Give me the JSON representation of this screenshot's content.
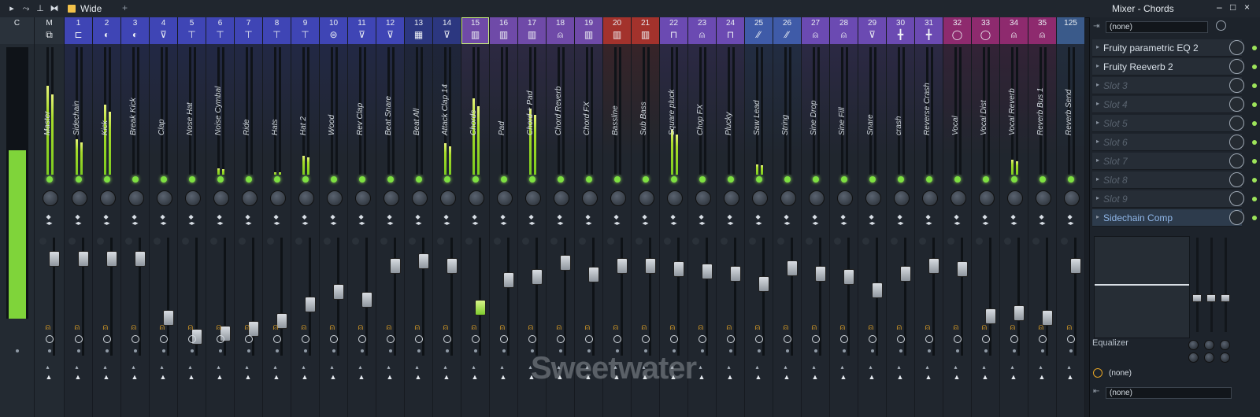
{
  "titlebar": {
    "preset_label": "Wide",
    "plus_label": "+",
    "window_title": "Mixer - Chords",
    "minimize": "–",
    "maximize": "□",
    "close": "×"
  },
  "colors": {
    "accent_green": "#7ee041",
    "meter_fill": "#9fdc2b",
    "route_orange": "#e6a525"
  },
  "tracks": [
    {
      "num": "C",
      "name": "",
      "icon": "",
      "color": "#2a323b",
      "meter": 0.62,
      "fader": 0.0,
      "kind": "current"
    },
    {
      "num": "M",
      "name": "Master",
      "icon": "⧉",
      "color": "#2a323b",
      "meter": 0.7,
      "fader": 0.87
    },
    {
      "num": "1",
      "name": "Sidechain",
      "icon": "⊏",
      "color": "#3f45b5",
      "meter": 0.28,
      "fader": 0.87
    },
    {
      "num": "2",
      "name": "Kick",
      "icon": "◐",
      "color": "#3f45b5",
      "meter": 0.55,
      "fader": 0.87
    },
    {
      "num": "3",
      "name": "Break Kick",
      "icon": "◐",
      "color": "#3f45b5",
      "meter": 0.0,
      "fader": 0.87
    },
    {
      "num": "4",
      "name": "Clap",
      "icon": "⊽",
      "color": "#3f45b5",
      "meter": 0.0,
      "fader": 0.3
    },
    {
      "num": "5",
      "name": "Nose Hat",
      "icon": "⊤",
      "color": "#3f45b5",
      "meter": 0.0,
      "fader": 0.12
    },
    {
      "num": "6",
      "name": "Noise Cymbal",
      "icon": "⊤",
      "color": "#3f45b5",
      "meter": 0.05,
      "fader": 0.15
    },
    {
      "num": "7",
      "name": "Ride",
      "icon": "⊤",
      "color": "#3f45b5",
      "meter": 0.0,
      "fader": 0.2
    },
    {
      "num": "8",
      "name": "Hats",
      "icon": "⊤",
      "color": "#3f45b5",
      "meter": 0.02,
      "fader": 0.27
    },
    {
      "num": "9",
      "name": "Hat 2",
      "icon": "⊤",
      "color": "#3f45b5",
      "meter": 0.15,
      "fader": 0.43
    },
    {
      "num": "10",
      "name": "Wood",
      "icon": "⊜",
      "color": "#3f45b5",
      "meter": 0.0,
      "fader": 0.55
    },
    {
      "num": "11",
      "name": "Rev Clap",
      "icon": "⊽",
      "color": "#3f45b5",
      "meter": 0.0,
      "fader": 0.48
    },
    {
      "num": "12",
      "name": "Beat Snare",
      "icon": "⊽",
      "color": "#3f45b5",
      "meter": 0.0,
      "fader": 0.8
    },
    {
      "num": "13",
      "name": "Beat All",
      "icon": "▦",
      "color": "#2c3780",
      "meter": 0.0,
      "fader": 0.85
    },
    {
      "num": "14",
      "name": "Attack Clap 14",
      "icon": "⊽",
      "color": "#2c3780",
      "meter": 0.25,
      "fader": 0.8
    },
    {
      "num": "15",
      "name": "Chords",
      "icon": "▥",
      "color": "#6f4aa8",
      "meter": 0.6,
      "fader": 0.4,
      "selected": true
    },
    {
      "num": "16",
      "name": "Pad",
      "icon": "▥",
      "color": "#6f4aa8",
      "meter": 0.0,
      "fader": 0.67
    },
    {
      "num": "17",
      "name": "Chord + Pad",
      "icon": "▥",
      "color": "#6f4aa8",
      "meter": 0.52,
      "fader": 0.7
    },
    {
      "num": "18",
      "name": "Chord Reverb",
      "icon": "⍝",
      "color": "#6f4aa8",
      "meter": 0.0,
      "fader": 0.83
    },
    {
      "num": "19",
      "name": "Chord FX",
      "icon": "▥",
      "color": "#6f4aa8",
      "meter": 0.0,
      "fader": 0.72
    },
    {
      "num": "20",
      "name": "Bassline",
      "icon": "▥",
      "color": "#a3322c",
      "meter": 0.0,
      "fader": 0.8
    },
    {
      "num": "21",
      "name": "Sub Bass",
      "icon": "▥",
      "color": "#a3322c",
      "meter": 0.0,
      "fader": 0.8
    },
    {
      "num": "22",
      "name": "Square pluck",
      "icon": "⊓",
      "color": "#6b4ab2",
      "meter": 0.35,
      "fader": 0.77
    },
    {
      "num": "23",
      "name": "Chop FX",
      "icon": "⍝",
      "color": "#6b4ab2",
      "meter": 0.0,
      "fader": 0.75
    },
    {
      "num": "24",
      "name": "Plucky",
      "icon": "⊓",
      "color": "#6b4ab2",
      "meter": 0.0,
      "fader": 0.73
    },
    {
      "num": "25",
      "name": "Saw Lead",
      "icon": "∕∕",
      "color": "#3f5ba8",
      "meter": 0.08,
      "fader": 0.63
    },
    {
      "num": "26",
      "name": "String",
      "icon": "∕∕",
      "color": "#3f5ba8",
      "meter": 0.0,
      "fader": 0.78
    },
    {
      "num": "27",
      "name": "Sine Drop",
      "icon": "⍝",
      "color": "#6b4ab2",
      "meter": 0.0,
      "fader": 0.73
    },
    {
      "num": "28",
      "name": "Sine Fill",
      "icon": "⍝",
      "color": "#6b4ab2",
      "meter": 0.0,
      "fader": 0.7
    },
    {
      "num": "29",
      "name": "Snare",
      "icon": "⊽",
      "color": "#6b4ab2",
      "meter": 0.0,
      "fader": 0.57
    },
    {
      "num": "30",
      "name": "crash",
      "icon": "╋",
      "color": "#6b4ab2",
      "meter": 0.0,
      "fader": 0.73
    },
    {
      "num": "31",
      "name": "Reverse Crash",
      "icon": "╋",
      "color": "#6b4ab2",
      "meter": 0.0,
      "fader": 0.8
    },
    {
      "num": "32",
      "name": "Vocal",
      "icon": "◯",
      "color": "#8e2a6e",
      "meter": 0.0,
      "fader": 0.77
    },
    {
      "num": "33",
      "name": "Vocal Dist",
      "icon": "◯",
      "color": "#8e2a6e",
      "meter": 0.0,
      "fader": 0.32
    },
    {
      "num": "34",
      "name": "Vocal Reverb",
      "icon": "⍝",
      "color": "#8e2a6e",
      "meter": 0.12,
      "fader": 0.35
    },
    {
      "num": "35",
      "name": "Reverb Bus 1",
      "icon": "⍝",
      "color": "#8e2a6e",
      "meter": 0.0,
      "fader": 0.3
    },
    {
      "num": "125",
      "name": "Reverb Send",
      "icon": "",
      "color": "#3a5a8a",
      "meter": 0.0,
      "fader": 0.8
    }
  ],
  "panel": {
    "input_select": "(none)",
    "slots": [
      {
        "label": "Fruity parametric EQ 2",
        "active": true
      },
      {
        "label": "Fruity Reeverb 2",
        "active": true
      },
      {
        "label": "Slot 3",
        "active": false
      },
      {
        "label": "Slot 4",
        "active": false
      },
      {
        "label": "Slot 5",
        "active": false
      },
      {
        "label": "Slot 6",
        "active": false
      },
      {
        "label": "Slot 7",
        "active": false
      },
      {
        "label": "Slot 8",
        "active": false
      },
      {
        "label": "Slot 9",
        "active": false
      },
      {
        "label": "Sidechain Comp",
        "active": true
      }
    ],
    "eq_label": "Equalizer",
    "output_select_1": "(none)",
    "output_select_2": "(none)"
  },
  "watermark": "Sweetwater"
}
